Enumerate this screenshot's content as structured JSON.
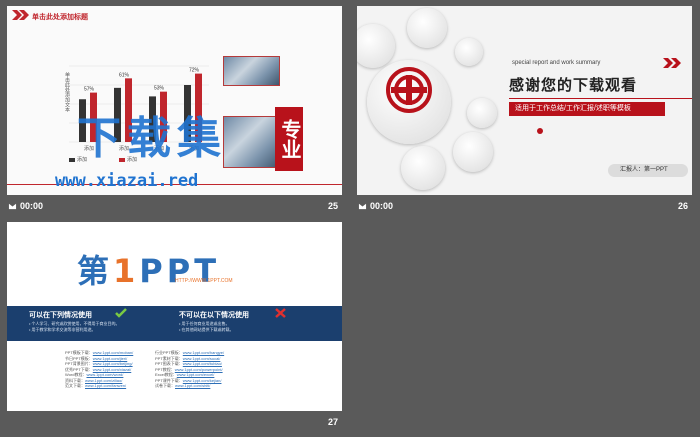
{
  "slides": [
    {
      "id": "s25",
      "number": "25",
      "time": "00:00",
      "title": "单击此处添加标题",
      "vertical_label": "单击此处添加文本",
      "watermark": {
        "text": "下载集",
        "url": "www.xiazai.red",
        "seal": "专业"
      },
      "legend": [
        "添加",
        "添加"
      ],
      "chart_data": {
        "type": "bar",
        "categories": [
          "添加",
          "添加",
          "添加",
          "添加"
        ],
        "series": [
          {
            "name": "",
            "values": [
              45,
              57,
              48,
              60
            ],
            "color": "#333333"
          },
          {
            "name": "",
            "values": [
              52,
              67,
              53,
              72
            ],
            "color": "#c0262d"
          }
        ],
        "data_labels": [
          "57%",
          "61%",
          "53%",
          "72%"
        ],
        "ylim": [
          0,
          80
        ]
      }
    },
    {
      "id": "s26",
      "number": "26",
      "time": "00:00",
      "subtitle_en": "special report and work summary",
      "title": "感谢您的下载观看",
      "tagline": "适用于工作总结/工作汇报/述职等模板",
      "reporter": "汇报人：第一PPT"
    },
    {
      "id": "s27",
      "number": "27",
      "brand": {
        "prefix": "第",
        "one": "1",
        "suffix": "PPT",
        "url": "HTTP://WWW.1PPT.COM"
      },
      "allowed": {
        "title": "可以在下列情况使用",
        "lines": [
          "• 个人学习、研究或欣赏使用，不得用于商业目的。",
          "• 用于教学和学术交流等非营利用途。"
        ]
      },
      "forbidden": {
        "title": "不可以在以下情况使用",
        "lines": [
          "• 用于任何商业用途或出售。",
          "• 在其他网站提供下载或转载。"
        ]
      },
      "links_left": [
        [
          "PPT模板下载：",
          "www.1ppt.com/moban/"
        ],
        [
          "节日PPT模板：",
          "www.1ppt.com/jieri/"
        ],
        [
          "PPT背景图片：",
          "www.1ppt.com/beijing/"
        ],
        [
          "优秀PPT下载：",
          "www.1ppt.com/xiazai/"
        ],
        [
          "Word教程：",
          "www.1ppt.com/word/"
        ],
        [
          "资料下载：",
          "www.1ppt.com/ziliao/"
        ],
        [
          "范文下载：",
          "www.1ppt.com/fanwen/"
        ]
      ],
      "links_right": [
        [
          "行业PPT模板：",
          "www.1ppt.com/hangye/"
        ],
        [
          "PPT素材下载：",
          "www.1ppt.com/sucai/"
        ],
        [
          "PPT图表下载：",
          "www.1ppt.com/tubiao/"
        ],
        [
          "PPT教程：",
          "www.1ppt.com/powerpoint/"
        ],
        [
          "Excel教程：",
          "www.1ppt.com/excel/"
        ],
        [
          "PPT课件下载：",
          "www.1ppt.com/kejian/"
        ],
        [
          "试卷下载：",
          "www.1ppt.com/shiti/"
        ]
      ]
    }
  ]
}
